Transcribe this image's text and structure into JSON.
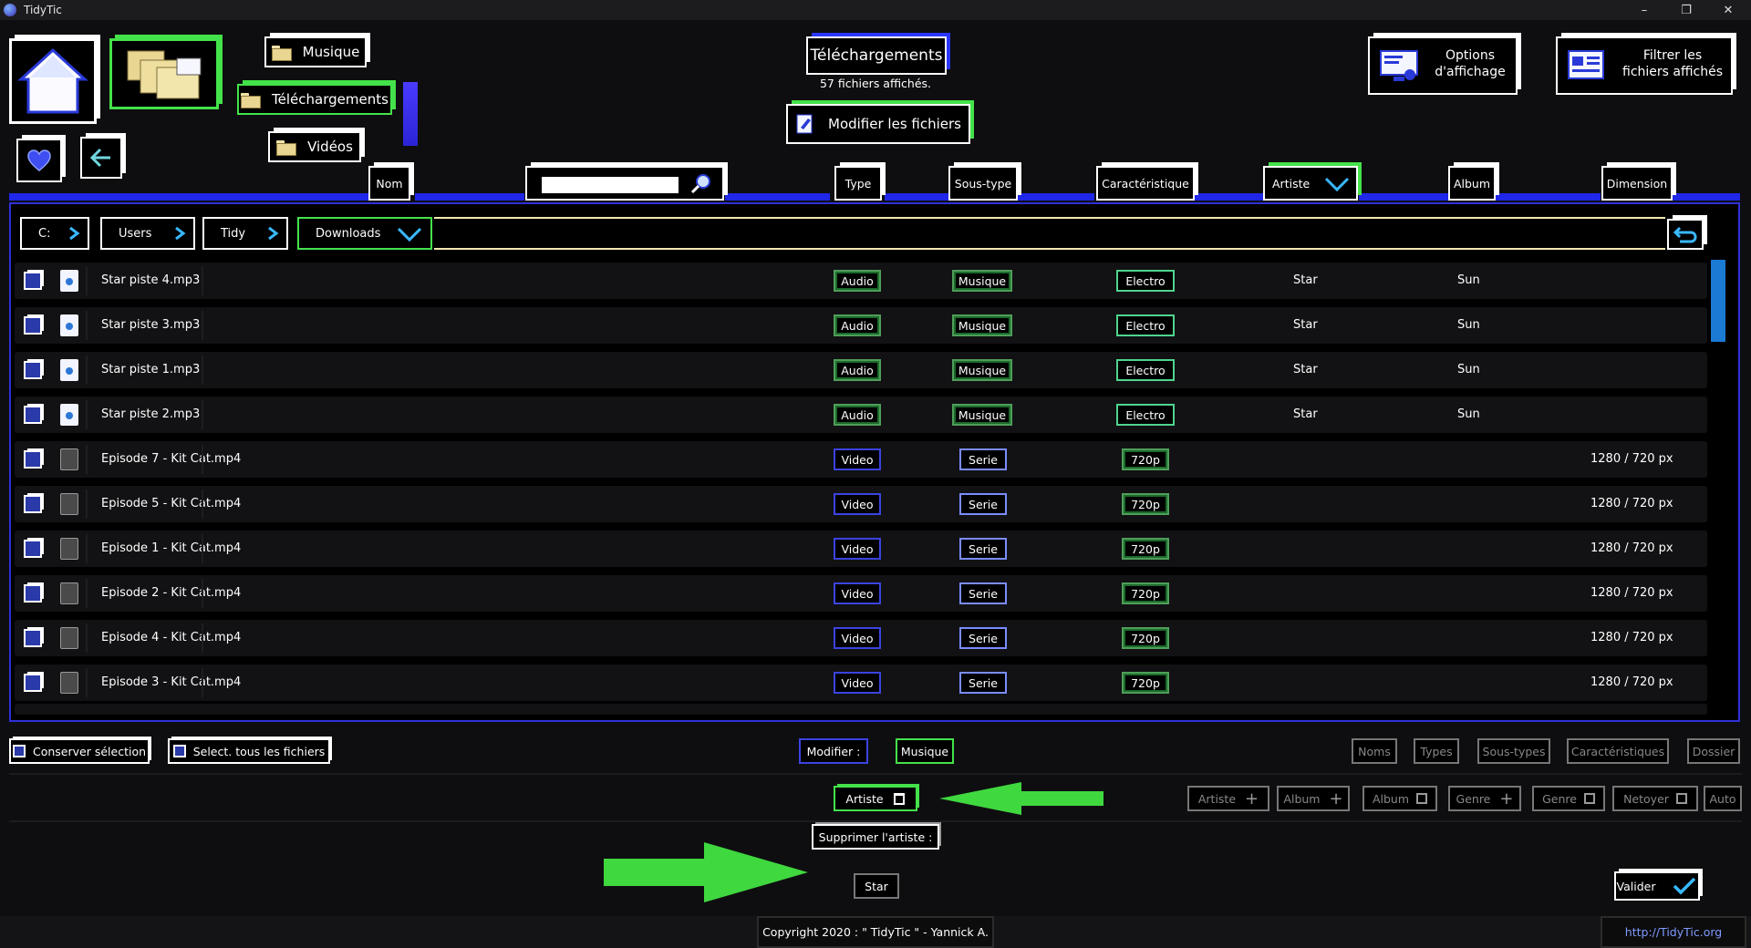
{
  "window": {
    "title": "TidyTic"
  },
  "top": {
    "nav_musique": "Musique",
    "nav_telechargements": "Téléchargements",
    "nav_videos": "Vidéos",
    "section_title": "Téléchargements",
    "file_count": "57 fichiers affichés.",
    "modify_files": "Modifier les fichiers",
    "options_line1": "Options",
    "options_line2": "d'affichage",
    "filter_line1": "Filtrer les",
    "filter_line2": "fichiers affichés"
  },
  "columns": {
    "nom": "Nom",
    "type": "Type",
    "sous_type": "Sous-type",
    "caracteristique": "Caractéristique",
    "artiste": "Artiste",
    "album": "Album",
    "dimension": "Dimension"
  },
  "breadcrumb": [
    "C:",
    "Users",
    "Tidy",
    "Downloads"
  ],
  "rows": [
    {
      "name": "Star piste 4.mp3",
      "kind": "audio",
      "type": "Audio",
      "subtype": "Musique",
      "feature": "Electro",
      "artist": "Star",
      "album": "Sun",
      "dimension": ""
    },
    {
      "name": "Star piste 3.mp3",
      "kind": "audio",
      "type": "Audio",
      "subtype": "Musique",
      "feature": "Electro",
      "artist": "Star",
      "album": "Sun",
      "dimension": ""
    },
    {
      "name": "Star piste 1.mp3",
      "kind": "audio",
      "type": "Audio",
      "subtype": "Musique",
      "feature": "Electro",
      "artist": "Star",
      "album": "Sun",
      "dimension": ""
    },
    {
      "name": "Star piste 2.mp3",
      "kind": "audio",
      "type": "Audio",
      "subtype": "Musique",
      "feature": "Electro",
      "artist": "Star",
      "album": "Sun",
      "dimension": ""
    },
    {
      "name": "Episode 7 - Kit Cat.mp4",
      "kind": "video",
      "type": "Video",
      "subtype": "Serie",
      "feature": "720p",
      "artist": "",
      "album": "",
      "dimension": "1280 / 720 px"
    },
    {
      "name": "Episode 5 - Kit Cat.mp4",
      "kind": "video",
      "type": "Video",
      "subtype": "Serie",
      "feature": "720p",
      "artist": "",
      "album": "",
      "dimension": "1280 / 720 px"
    },
    {
      "name": "Episode 1 - Kit Cat.mp4",
      "kind": "video",
      "type": "Video",
      "subtype": "Serie",
      "feature": "720p",
      "artist": "",
      "album": "",
      "dimension": "1280 / 720 px"
    },
    {
      "name": "Episode 2 - Kit Cat.mp4",
      "kind": "video",
      "type": "Video",
      "subtype": "Serie",
      "feature": "720p",
      "artist": "",
      "album": "",
      "dimension": "1280 / 720 px"
    },
    {
      "name": "Episode 4 - Kit Cat.mp4",
      "kind": "video",
      "type": "Video",
      "subtype": "Serie",
      "feature": "720p",
      "artist": "",
      "album": "",
      "dimension": "1280 / 720 px"
    },
    {
      "name": "Episode 3 - Kit Cat.mp4",
      "kind": "video",
      "type": "Video",
      "subtype": "Serie",
      "feature": "720p",
      "artist": "",
      "album": "",
      "dimension": "1280 / 720 px"
    }
  ],
  "bottom": {
    "keep_selection": "Conserver sélection",
    "select_all": "Select. tous les fichiers",
    "modifier": "Modifier :",
    "musique": "Musique",
    "filters": [
      "Noms",
      "Types",
      "Sous-types",
      "Caractéristiques",
      "Dossier"
    ],
    "artiste": "Artiste",
    "actions": [
      {
        "label": "Artiste",
        "icon": "plus-icon"
      },
      {
        "label": "Album",
        "icon": "plus-icon"
      },
      {
        "label": "Album",
        "icon": "trash-icon"
      },
      {
        "label": "Genre",
        "icon": "plus-icon"
      },
      {
        "label": "Genre",
        "icon": "trash-icon"
      },
      {
        "label": "Netoyer",
        "icon": "trash-icon"
      },
      {
        "label": "Auto",
        "icon": ""
      }
    ],
    "delete_artist": "Supprimer l'artiste :",
    "star": "Star",
    "validate": "Valider"
  },
  "footer": {
    "copyright": "Copyright 2020 : \" TidyTic \" - Yannick A.",
    "link": "http://TidyTic.org"
  }
}
